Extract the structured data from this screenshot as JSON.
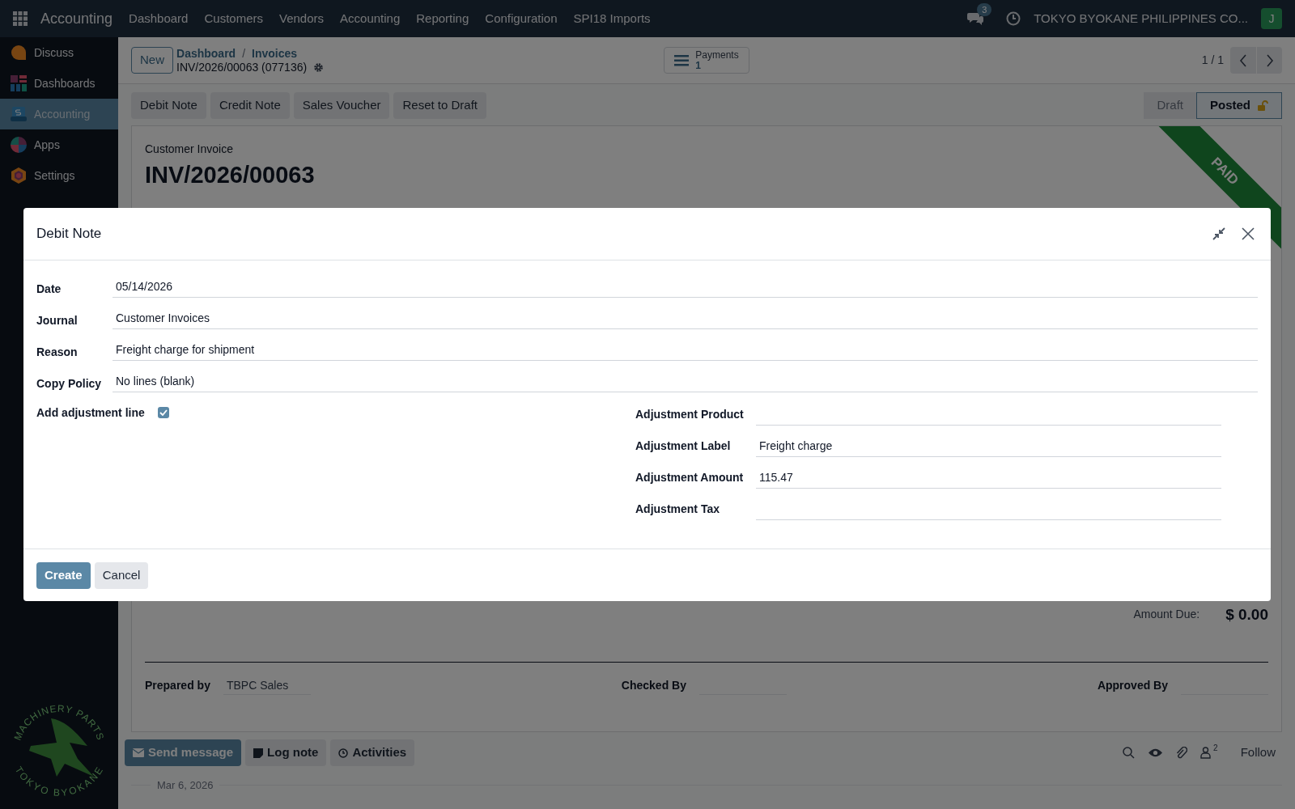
{
  "navbar": {
    "app_name": "Accounting",
    "menu": [
      "Dashboard",
      "Customers",
      "Vendors",
      "Accounting",
      "Reporting",
      "Configuration",
      "SPI18 Imports"
    ],
    "message_count": "3",
    "company": "TOKYO BYOKANE PHILIPPINES CO...",
    "avatar": "J"
  },
  "sidebar": {
    "items": [
      {
        "label": "Discuss",
        "kind": "discuss",
        "selected": false
      },
      {
        "label": "Dashboards",
        "kind": "dashboards",
        "selected": false
      },
      {
        "label": "Accounting",
        "kind": "accounting",
        "selected": true
      },
      {
        "label": "Apps",
        "kind": "apps",
        "selected": false
      },
      {
        "label": "Settings",
        "kind": "settings",
        "selected": false
      }
    ],
    "logo_text": {
      "top": "MACHINERY PARTS",
      "bottom": "TOKYO BYOKANE"
    }
  },
  "control_panel": {
    "new_button": "New",
    "breadcrumb": [
      "Dashboard",
      "Invoices"
    ],
    "breadcrumb_separator": "/",
    "record": "INV/2026/00063 (077136)",
    "payments": {
      "label": "Payments",
      "count": "1"
    },
    "pager": "1 / 1"
  },
  "action_buttons": [
    "Debit Note",
    "Credit Note",
    "Sales Voucher",
    "Reset to Draft"
  ],
  "status_steps": [
    {
      "label": "Draft",
      "selected": false
    },
    {
      "label": "Posted",
      "selected": true
    }
  ],
  "invoice": {
    "type": "Customer Invoice",
    "number": "INV/2026/00063",
    "ribbon": "PAID",
    "amount_due_label": "Amount Due:",
    "amount_due": "$ 0.00",
    "signatures": [
      {
        "label": "Prepared by",
        "value": "TBPC Sales"
      },
      {
        "label": "Checked By"
      },
      {
        "label": "Approved By"
      }
    ]
  },
  "chatter": {
    "buttons": [
      "Send message",
      "Log note",
      "Activities"
    ],
    "follower_count": "2",
    "follow": "Follow",
    "date_separator": "Mar 6, 2026"
  },
  "dialog": {
    "title": "Debit Note",
    "fields": [
      {
        "label": "Date",
        "value": "05/14/2026"
      },
      {
        "label": "Journal",
        "value": "Customer Invoices"
      },
      {
        "label": "Reason",
        "value": "Freight charge for shipment"
      },
      {
        "label": "Copy Policy",
        "value": "No lines (blank)"
      }
    ],
    "add_adjustment": {
      "label": "Add adjustment line",
      "checked": true
    },
    "adjustment_fields": [
      {
        "label": "Adjustment Product"
      },
      {
        "label": "Adjustment Label",
        "value": "Freight charge"
      },
      {
        "label": "Adjustment Amount",
        "value": "115.47"
      },
      {
        "label": "Adjustment Tax"
      }
    ],
    "buttons": [
      {
        "label": "Create",
        "kind": "primary"
      },
      {
        "label": "Cancel",
        "kind": "secondary"
      }
    ]
  }
}
